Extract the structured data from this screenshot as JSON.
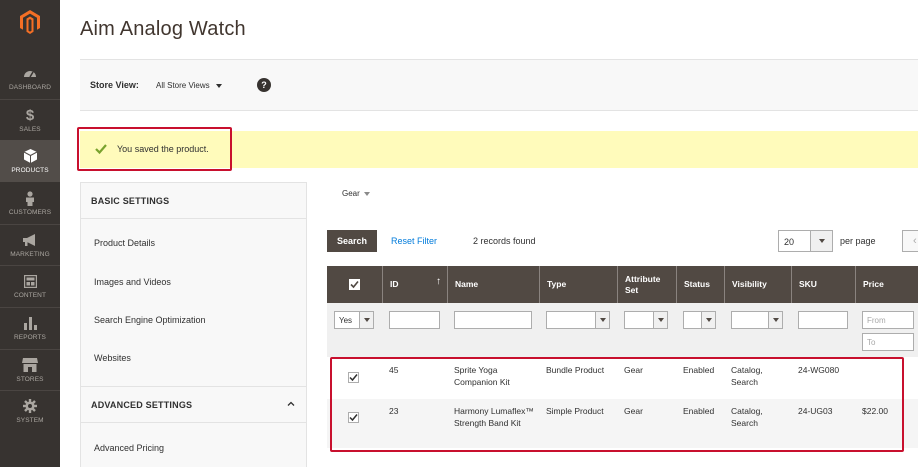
{
  "sidebar": {
    "items": [
      {
        "label": "DASHBOARD",
        "icon": "dashboard-icon"
      },
      {
        "label": "SALES",
        "icon": "dollar-icon"
      },
      {
        "label": "PRODUCTS",
        "icon": "cube-icon",
        "active": true
      },
      {
        "label": "CUSTOMERS",
        "icon": "person-icon"
      },
      {
        "label": "MARKETING",
        "icon": "megaphone-icon"
      },
      {
        "label": "CONTENT",
        "icon": "layout-icon"
      },
      {
        "label": "REPORTS",
        "icon": "bar-chart-icon"
      },
      {
        "label": "STORES",
        "icon": "store-icon"
      },
      {
        "label": "SYSTEM",
        "icon": "gear-icon"
      }
    ]
  },
  "header": {
    "title": "Aim Analog Watch"
  },
  "store_view": {
    "label": "Store View:",
    "value": "All Store Views",
    "help": "?"
  },
  "message": {
    "text": "You saved the product."
  },
  "left_panel": {
    "basic_title": "BASIC SETTINGS",
    "basic_items": [
      "Product Details",
      "Images and Videos",
      "Search Engine Optimization",
      "Websites"
    ],
    "advanced_title": "ADVANCED SETTINGS",
    "advanced_items": [
      "Advanced Pricing"
    ]
  },
  "grid": {
    "attribute_set_filter": "Gear",
    "search_label": "Search",
    "reset_label": "Reset Filter",
    "records_text": "2 records found",
    "per_page_value": "20",
    "per_page_label": "per page",
    "prev_label": "‹",
    "columns": [
      "ID",
      "Name",
      "Type",
      "Attribute Set",
      "Status",
      "Visibility",
      "SKU",
      "Price"
    ],
    "sort_indicator": "↑",
    "filters": {
      "in_product": "Yes",
      "price_from_placeholder": "From",
      "price_to_placeholder": "To"
    },
    "rows": [
      {
        "checked": true,
        "id": "45",
        "name": "Sprite Yoga Companion Kit",
        "type": "Bundle Product",
        "attribute_set": "Gear",
        "status": "Enabled",
        "visibility": "Catalog, Search",
        "sku": "24-WG080",
        "price": ""
      },
      {
        "checked": true,
        "id": "23",
        "name": "Harmony Lumaflex™ Strength Band Kit",
        "type": "Simple Product",
        "attribute_set": "Gear",
        "status": "Enabled",
        "visibility": "Catalog, Search",
        "sku": "24-UG03",
        "price": "$22.00"
      }
    ]
  },
  "colors": {
    "sidebar": "#373330",
    "header_row": "#514943",
    "message_bg": "#fffbbb",
    "highlight": "#c8102e",
    "link": "#007bdb"
  }
}
